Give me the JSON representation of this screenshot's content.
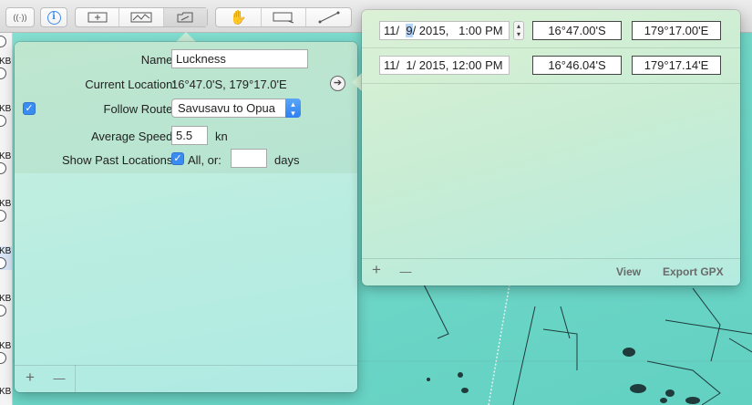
{
  "toolbar": {
    "buttons": [
      {
        "icon": "broadcast-icon",
        "glyph": "((·))"
      },
      {
        "icon": "info-icon",
        "glyph": "i"
      },
      {
        "icon": "add-waypoint-icon"
      },
      {
        "icon": "route-icon"
      },
      {
        "icon": "vessel-folder-icon"
      },
      {
        "icon": "pan-hand-icon"
      },
      {
        "icon": "zoom-rectangle-icon"
      },
      {
        "icon": "measure-line-icon"
      }
    ],
    "accent_color": "#3b8cf0"
  },
  "left_strip": {
    "rows": [
      "KB",
      "KB",
      "KB",
      "KB",
      "KB",
      "KB",
      "KB",
      "KB"
    ]
  },
  "vessel": {
    "name_label": "Name:",
    "name_value": "Luckness",
    "current_location_label": "Current Location:",
    "current_location_value": "16°47.0'S, 179°17.0'E",
    "follow_route_label": "Follow Route:",
    "follow_route_value": "Savusavu to Opua",
    "average_speed_label": "Average Speed:",
    "average_speed_value": "5.5",
    "speed_unit": "kn",
    "show_past_label": "Show Past Locations:",
    "show_past_all_label": "All, or:",
    "show_past_days_value": "",
    "days_label": "days",
    "add_glyph": "+",
    "remove_glyph": "—"
  },
  "track": {
    "rows": [
      {
        "date_prefix": "11/  ",
        "date_sel": "9",
        "date_suffix": "/ 2015,   1:00 PM",
        "lat": "16°47.00'S",
        "lon": "179°17.00'E"
      },
      {
        "date_prefix": "11/  1/ 2015, 12:00 PM",
        "date_sel": "",
        "date_suffix": "",
        "lat": "16°46.04'S",
        "lon": "179°17.14'E"
      }
    ],
    "add_glyph": "+",
    "remove_glyph": "—",
    "view_label": "View",
    "export_label": "Export GPX"
  }
}
